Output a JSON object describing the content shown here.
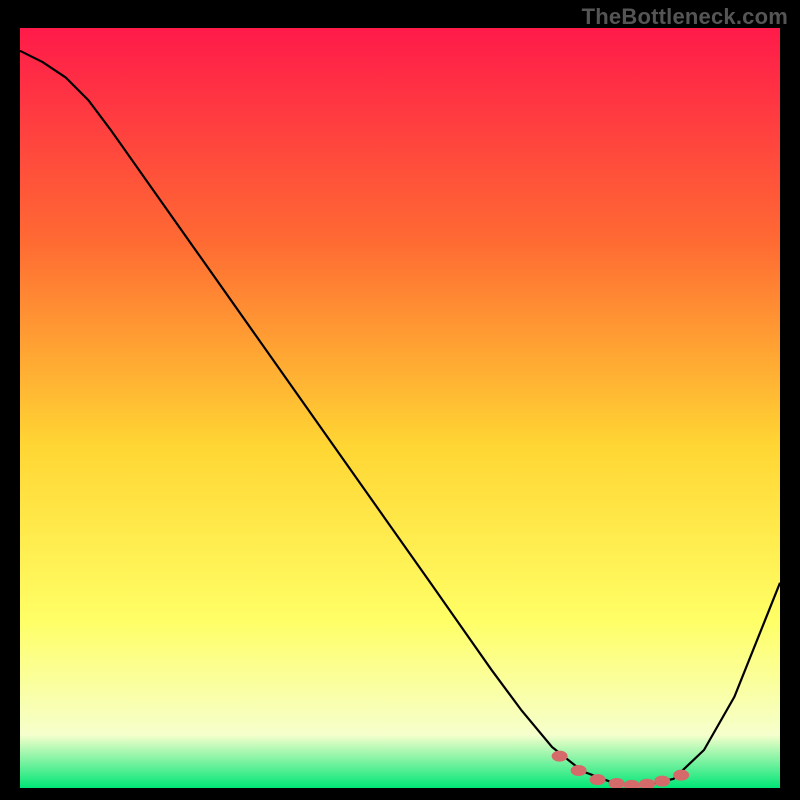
{
  "attribution": "TheBottleneck.com",
  "colors": {
    "page_bg": "#000000",
    "frame_border": "#000000",
    "curve_stroke": "#000000",
    "marker_fill": "#d56a6a",
    "attribution_text": "#555555",
    "gradient_top": "#ff1a4a",
    "gradient_upper_mid": "#ff6a33",
    "gradient_mid": "#ffd633",
    "gradient_lower_mid": "#ffff66",
    "gradient_near_bottom": "#f6ffcc",
    "gradient_bottom": "#00e676"
  },
  "chart_data": {
    "type": "line",
    "title": "",
    "xlabel": "",
    "ylabel": "",
    "xlim": [
      0,
      100
    ],
    "ylim": [
      0,
      100
    ],
    "series": [
      {
        "name": "bottleneck-curve",
        "x": [
          0.0,
          3.0,
          6.0,
          9.0,
          12.0,
          18.0,
          24.0,
          30.0,
          36.0,
          42.0,
          48.0,
          54.0,
          58.0,
          62.0,
          66.0,
          70.0,
          74.0,
          78.0,
          82.0,
          86.0,
          90.0,
          94.0,
          98.0,
          100.0
        ],
        "values": [
          97.0,
          95.5,
          93.5,
          90.5,
          86.5,
          78.0,
          69.5,
          61.0,
          52.5,
          44.0,
          35.5,
          27.0,
          21.3,
          15.6,
          10.2,
          5.4,
          2.2,
          0.7,
          0.3,
          1.2,
          5.0,
          12.0,
          22.0,
          27.0
        ]
      }
    ],
    "markers": {
      "name": "trough-markers",
      "x": [
        71.0,
        73.5,
        76.0,
        78.5,
        80.5,
        82.5,
        84.5,
        87.0
      ],
      "values": [
        4.2,
        2.3,
        1.1,
        0.6,
        0.35,
        0.5,
        0.9,
        1.7
      ]
    },
    "notes": "V-shaped curve over a vertical rainbow heat gradient. Minimum near x≈81. Small red-ish dot markers cluster along the trough."
  }
}
